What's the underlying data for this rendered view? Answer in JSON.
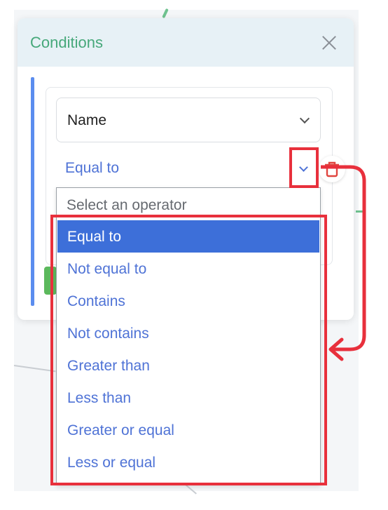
{
  "panel": {
    "title": "Conditions",
    "close_icon": "close-icon"
  },
  "field_select": {
    "value": "Name",
    "icon": "chevron-down-icon"
  },
  "operator_select": {
    "value": "Equal to",
    "icon": "chevron-down-icon"
  },
  "delete_icon": "trash-icon",
  "dropdown": {
    "placeholder": "Select an operator",
    "selected": "Equal to",
    "options": [
      "Equal to",
      "Not equal to",
      "Contains",
      "Not contains",
      "Greater than",
      "Less than",
      "Greater or equal",
      "Less or equal"
    ]
  },
  "colors": {
    "title_green": "#46a87a",
    "accent_blue": "#5b8def",
    "option_blue": "#4f73d6",
    "selected_bg": "#3d6fd9",
    "annotation_red": "#e8303c",
    "delete_red": "#e0453f"
  }
}
